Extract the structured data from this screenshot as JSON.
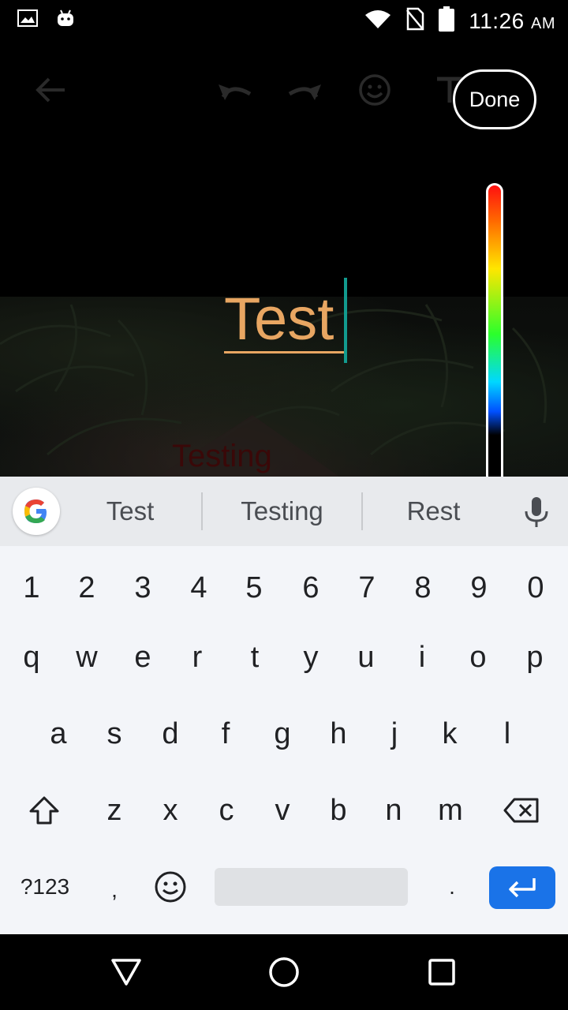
{
  "status_bar": {
    "time": "11:26",
    "ampm": "AM",
    "icons": [
      "gallery-icon",
      "android-icon",
      "wifi-icon",
      "no-sim-icon",
      "battery-icon"
    ]
  },
  "toolbar": {
    "icons": [
      "back-arrow-icon",
      "undo-icon",
      "redo-icon",
      "emoji-icon",
      "text-icon",
      "pen-icon"
    ],
    "done_label": "Done"
  },
  "canvas": {
    "edit_text": "Test",
    "edit_text_color": "#e8a662",
    "ghost_text": "Testing",
    "ghost_text_color": "#3a0808"
  },
  "keyboard": {
    "suggestions": [
      "Test",
      "Testing",
      "Rest"
    ],
    "number_row": [
      "1",
      "2",
      "3",
      "4",
      "5",
      "6",
      "7",
      "8",
      "9",
      "0"
    ],
    "row1": [
      "q",
      "w",
      "e",
      "r",
      "t",
      "y",
      "u",
      "i",
      "o",
      "p"
    ],
    "row2": [
      "a",
      "s",
      "d",
      "f",
      "g",
      "h",
      "j",
      "k",
      "l"
    ],
    "row3": [
      "z",
      "x",
      "c",
      "v",
      "b",
      "n",
      "m"
    ],
    "symbols_label": "?123",
    "comma": ",",
    "period": ".",
    "accent_color": "#1a73e8"
  },
  "nav_bar": {
    "icons": [
      "back-triangle-icon",
      "home-circle-icon",
      "recents-square-icon"
    ]
  }
}
